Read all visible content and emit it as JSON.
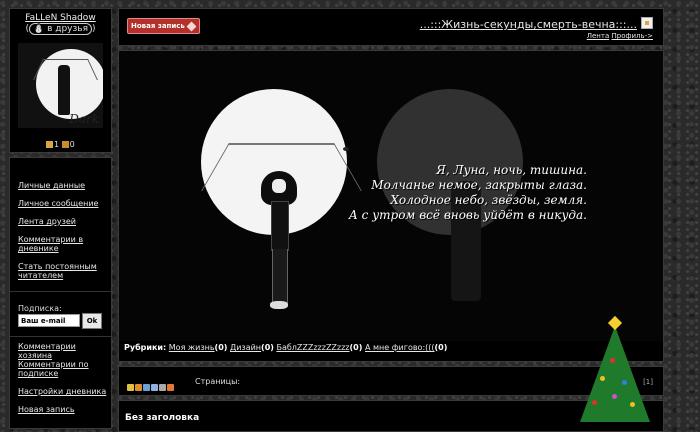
{
  "profile": {
    "username": "FaLLeN Shadow",
    "add_friend_label": "в друзья",
    "avatar_signature": "Dark",
    "count_a": "1",
    "count_b": "0"
  },
  "sidebar": {
    "items": [
      {
        "label": "Личные данные"
      },
      {
        "label": "Личное сообщение"
      },
      {
        "label": "Лента друзей"
      },
      {
        "label": "Комментарии в дневнике"
      },
      {
        "label": "Стать постоянным читателем"
      }
    ],
    "subscribe_label": "Подписка:",
    "email_placeholder": "Ваш e-mail",
    "ok_label": "Ok",
    "bottom_items": [
      {
        "label": "Комментарии хозяина"
      },
      {
        "label": "Комментарии по подписке"
      },
      {
        "label": "Настройки дневника"
      },
      {
        "label": "Новая запись"
      }
    ]
  },
  "header": {
    "new_post_label": "Новая запись",
    "blog_title": "...:::Жизнь-секунды,смерть-вечна:::...",
    "lenta_label": "Лента",
    "profile_label": "Профиль->"
  },
  "post": {
    "poem": [
      "Я, Луна, ночь, тишина.",
      "Молчанье немое, закрыты глаза.",
      "Холодное небо, звёзды, земля.",
      "А с утром всё вновь уйдёт в никуда."
    ],
    "rubrics_label": "Рубрики:",
    "rubrics": [
      {
        "name": "Моя жизнь",
        "count": "(0)"
      },
      {
        "name": "Дизайн",
        "count": "(0)"
      },
      {
        "name": "БаблZZZzzzZZzzz",
        "count": "(0)"
      },
      {
        "name": "А мне фигово:(((",
        "count": "(0)"
      }
    ]
  },
  "footer": {
    "pages_label": "Страницы:",
    "page_num": "[1]"
  },
  "post2": {
    "title": "Без заголовка"
  },
  "colors": {
    "new_post_button": "#b3312a",
    "background": "#2a2a2a",
    "panel": "#000000"
  }
}
